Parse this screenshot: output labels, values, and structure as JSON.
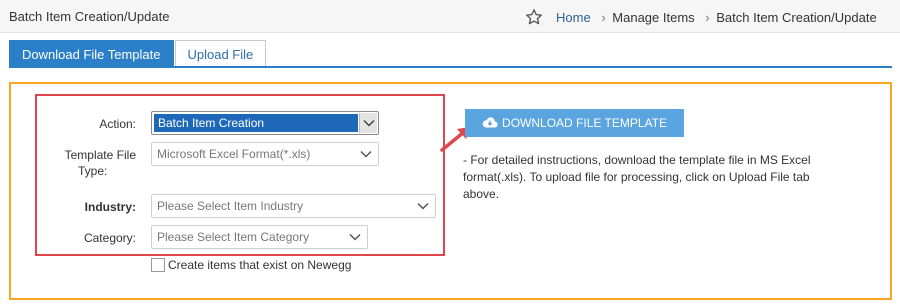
{
  "header": {
    "title": "Batch Item Creation/Update",
    "breadcrumb": {
      "home": "Home",
      "items": [
        "Manage Items",
        "Batch Item Creation/Update"
      ]
    }
  },
  "tabs": [
    {
      "label": "Download File Template",
      "active": true
    },
    {
      "label": "Upload File",
      "active": false
    }
  ],
  "form": {
    "action": {
      "label": "Action:",
      "value": "Batch Item Creation"
    },
    "template_file_type": {
      "label_line1": "Template File",
      "label_line2": "Type:",
      "value": "Microsoft Excel Format(*.xls)"
    },
    "industry": {
      "label": "Industry:",
      "placeholder": "Please Select Item Industry"
    },
    "category": {
      "label": "Category:",
      "placeholder": "Please Select Item Category"
    },
    "create_existing": {
      "label": "Create items that exist on Newegg",
      "checked": false
    }
  },
  "download": {
    "button_label": "DOWNLOAD FILE TEMPLATE",
    "instructions": "- For detailed instructions, download the template file in MS Excel format(.xls). To upload file for processing, click on Upload File tab above."
  },
  "colors": {
    "accent": "#2b7fc8",
    "panel_border": "#f5a623",
    "highlight": "#e0474c",
    "button": "#5aa4e0"
  },
  "icons": [
    "star-icon",
    "chevron-down-icon",
    "cloud-download-icon",
    "arrow-icon"
  ]
}
